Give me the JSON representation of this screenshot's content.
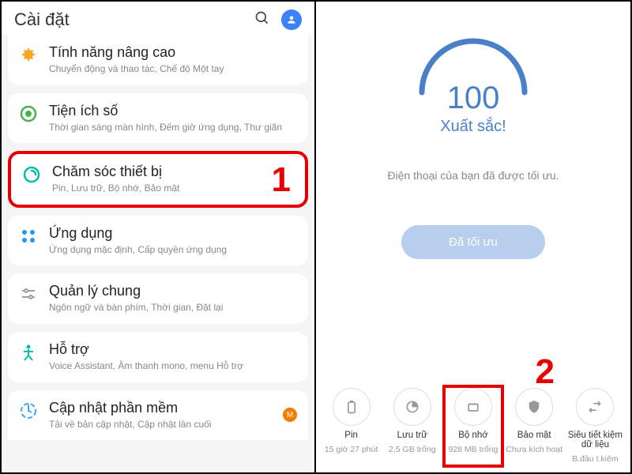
{
  "left": {
    "header": {
      "title": "Cài đặt"
    },
    "items": [
      {
        "title": "Tính năng nâng cao",
        "sub": "Chuyển động và thao tác, Chế độ Một tay"
      },
      {
        "title": "Tiện ích số",
        "sub": "Thời gian sáng màn hình, Đếm giờ ứng dụng, Thư giãn"
      },
      {
        "title": "Chăm sóc thiết bị",
        "sub": "Pin, Lưu trữ, Bộ nhớ, Bảo mật"
      },
      {
        "title": "Ứng dụng",
        "sub": "Ứng dụng mặc định, Cấp quyền ứng dụng"
      },
      {
        "title": "Quản lý chung",
        "sub": "Ngôn ngữ và bàn phím, Thời gian, Đặt lại"
      },
      {
        "title": "Hỗ trợ",
        "sub": "Voice Assistant, Âm thanh mono, menu Hỗ trợ"
      },
      {
        "title": "Cập nhật phần mềm",
        "sub": "Tải về bản cập nhật, Cập nhật lần cuối"
      }
    ],
    "step1": "1"
  },
  "right": {
    "score": "100",
    "score_label": "Xuất sắc!",
    "message": "Điện thoại của bạn đã được tối ưu.",
    "button": "Đã tối ưu",
    "step2": "2",
    "cards": [
      {
        "title": "Pin",
        "sub": "15 giờ 27 phút"
      },
      {
        "title": "Lưu trữ",
        "sub": "2,5 GB trống"
      },
      {
        "title": "Bộ nhớ",
        "sub": "928 MB trống"
      },
      {
        "title": "Bảo mật",
        "sub": "Chưa kích hoạt"
      },
      {
        "title": "Siêu tiết kiệm dữ liệu",
        "sub": "B.đầu t.kiệm"
      }
    ]
  }
}
